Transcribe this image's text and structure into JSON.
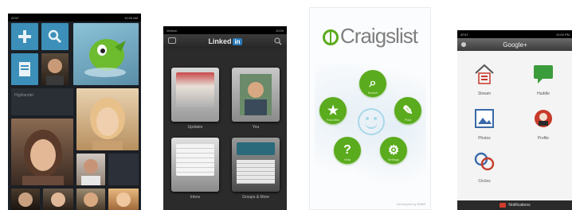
{
  "screens": {
    "metro": {
      "status": {
        "carrier": "AT&T",
        "time": "10:00 AM"
      },
      "tile_caption": "Highlander",
      "colors": {
        "bg": "#1c1f24",
        "tile": "#3c8fb8",
        "accent": "#7cc23c"
      }
    },
    "linkedin": {
      "status": {
        "carrier": "Verizon",
        "time": "10:00"
      },
      "brand": {
        "name": "Linked",
        "badge": "in"
      },
      "cards": [
        "Updates",
        "You",
        "Inbox",
        "Groups & More"
      ],
      "colors": {
        "bg": "#2b2b2b",
        "brand": "#2a79b8"
      }
    },
    "craigslist": {
      "title": "Craigslist",
      "buttons": [
        {
          "icon": "search-icon",
          "glyph": "⌕",
          "label": "Search"
        },
        {
          "icon": "star-icon",
          "glyph": "★",
          "label": "Favorites"
        },
        {
          "icon": "post-icon",
          "glyph": "✎",
          "label": "Post"
        },
        {
          "icon": "help-icon",
          "glyph": "?",
          "label": "Help"
        },
        {
          "icon": "settings-icon",
          "glyph": "⚙",
          "label": "Settings"
        }
      ],
      "footer": "Developed by SMMI",
      "colors": {
        "button": "#5aab1d",
        "bg": "#fbfcfd"
      }
    },
    "google": {
      "status": {
        "carrier": "AT&T",
        "time": "10:00 PM"
      },
      "title": "Google+",
      "items": [
        {
          "icon": "stream-icon",
          "label": "Stream"
        },
        {
          "icon": "huddle-icon",
          "label": "Huddle"
        },
        {
          "icon": "photos-icon",
          "label": "Photos"
        },
        {
          "icon": "profile-icon",
          "label": "Profile"
        },
        {
          "icon": "circles-icon",
          "label": "Circles"
        }
      ],
      "footer": "Notifications",
      "colors": {
        "accent": "#d23c2c",
        "huddle": "#3a9c3a"
      }
    }
  }
}
